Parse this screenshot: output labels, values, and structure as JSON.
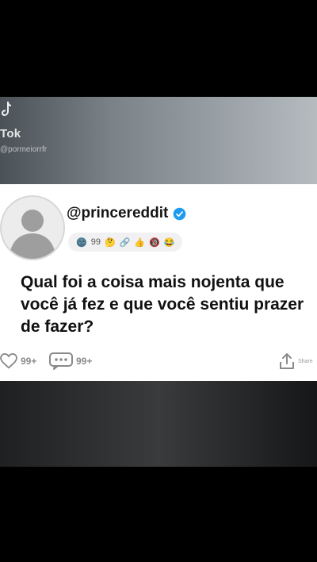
{
  "overlay": {
    "brand": "Tok",
    "handle": "@pormeiorrfr"
  },
  "post": {
    "username": "@princereddit",
    "badges": [
      "🌚",
      "99",
      "🤔",
      "🔗",
      "👍",
      "🔞",
      "😂"
    ],
    "question": "Qual foi a coisa mais nojenta que você já fez e que você sentiu prazer de fazer?",
    "likes": "99+",
    "comments": "99+",
    "share_label": "Share"
  },
  "colors": {
    "verified": "#1d9bf0",
    "card_bg": "#ffffff",
    "text": "#111111"
  },
  "icons": {
    "logo": "tiktok-icon",
    "verified": "verified-icon",
    "like": "heart-icon",
    "comment": "comment-icon",
    "share": "share-icon"
  }
}
